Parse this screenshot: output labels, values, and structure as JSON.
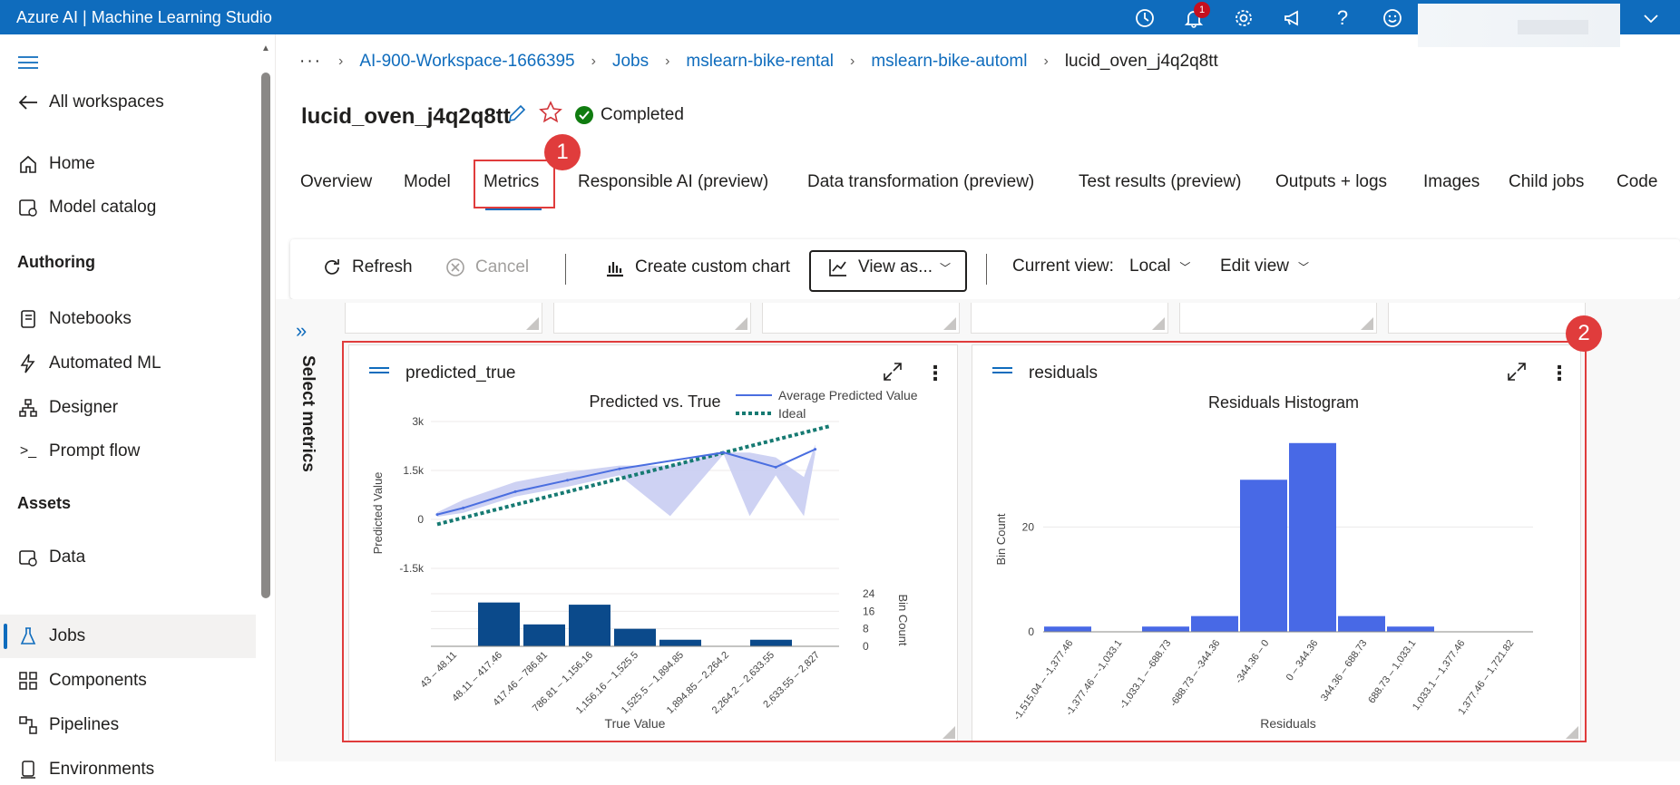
{
  "app": {
    "title": "Azure AI | Machine Learning Studio",
    "notification_count": "1"
  },
  "sidebar": {
    "all_workspaces": "All workspaces",
    "home": "Home",
    "model_catalog": "Model catalog",
    "authoring_header": "Authoring",
    "notebooks": "Notebooks",
    "automated_ml": "Automated ML",
    "designer": "Designer",
    "prompt_flow": "Prompt flow",
    "assets_header": "Assets",
    "data": "Data",
    "jobs": "Jobs",
    "components": "Components",
    "pipelines": "Pipelines",
    "environments": "Environments"
  },
  "breadcrumb": {
    "ellipsis": "···",
    "items": [
      "AI-900-Workspace-1666395",
      "Jobs",
      "mslearn-bike-rental",
      "mslearn-bike-automl"
    ],
    "current": "lucid_oven_j4q2q8tt"
  },
  "job": {
    "title": "lucid_oven_j4q2q8tt",
    "status": "Completed"
  },
  "tabs": [
    "Overview",
    "Model",
    "Metrics",
    "Responsible AI (preview)",
    "Data transformation (preview)",
    "Test results (preview)",
    "Outputs + logs",
    "Images",
    "Child jobs",
    "Code"
  ],
  "selected_tab": "Metrics",
  "toolbar": {
    "refresh": "Refresh",
    "cancel": "Cancel",
    "create_custom_chart": "Create custom chart",
    "view_as": "View as...",
    "current_view_label": "Current view:",
    "current_view_value": "Local",
    "edit_view": "Edit view"
  },
  "select_metrics": "Select metrics",
  "callouts": [
    "1",
    "2"
  ],
  "cards": {
    "predicted_true": {
      "name": "predicted_true"
    },
    "residuals": {
      "name": "residuals"
    }
  },
  "chart_data": [
    {
      "type": "line",
      "title": "Predicted vs. True",
      "xlabel": "True Value",
      "ylabel": "Predicted Value",
      "y_ticks": [
        "3k",
        "1.5k",
        "0",
        "-1.5k"
      ],
      "ylim": [
        -1500,
        3000
      ],
      "categories": [
        "43 – 48.11",
        "48.11 – 417.46",
        "417.46 – 786.81",
        "786.81 – 1,156.16",
        "1,156.16 – 1,525.5",
        "1,525.5 – 1,894.85",
        "1,894.85 – 2,264.2",
        "2,264.2 – 2,633.55",
        "2,633.55 – 2,827"
      ],
      "series": [
        {
          "name": "Average Predicted Value",
          "x": [
            45,
            230,
            600,
            970,
            1340,
            2080,
            2450,
            2730
          ],
          "values": [
            150,
            350,
            850,
            1200,
            1550,
            2050,
            1600,
            2150
          ]
        },
        {
          "name": "Ideal",
          "x": [
            45,
            2827
          ],
          "values": [
            -150,
            2850
          ]
        }
      ],
      "band": {
        "x": [
          45,
          230,
          600,
          970,
          1340,
          1700,
          2080,
          2265,
          2450,
          2650,
          2730
        ],
        "upper": [
          220,
          600,
          1150,
          1450,
          1650,
          1650,
          2050,
          2050,
          1900,
          1300,
          2300
        ],
        "lower": [
          80,
          200,
          700,
          1000,
          1350,
          100,
          2000,
          100,
          1350,
          100,
          2000
        ]
      },
      "histogram": {
        "title": "Bin Count",
        "y_ticks": [
          "24",
          "16",
          "8",
          "0"
        ],
        "ylim": [
          0,
          24
        ],
        "values": [
          0,
          20,
          10,
          19,
          8,
          3,
          0,
          3,
          0
        ]
      }
    },
    {
      "type": "bar",
      "title": "Residuals Histogram",
      "xlabel": "Residuals",
      "ylabel": "Bin Count",
      "y_ticks": [
        "20",
        "0"
      ],
      "ylim": [
        0,
        37
      ],
      "categories": [
        "-1,515.04 – -1,377.46",
        "-1,377.46 – -1,033.1",
        "-1,033.1 – -688.73",
        "-688.73 – -344.36",
        "-344.36 – 0",
        "0 – 344.36",
        "344.36 – 688.73",
        "688.73 – 1,033.1",
        "1,033.1 – 1,377.46",
        "1,377.46 – 1,721.82"
      ],
      "values": [
        1,
        0,
        1,
        3,
        29,
        36,
        3,
        1,
        0,
        0
      ]
    }
  ],
  "colors": {
    "accent": "#0f6cbd",
    "callout": "#e03c3c",
    "status_ok": "#107c10",
    "series_avg": "#4a6ee0",
    "series_ideal": "#167a72",
    "band": "#c9cdf2",
    "histogram_dark": "#0b4a8b",
    "histogram_residuals": "#4869e6"
  },
  "icons": {
    "topbar": [
      "history-icon",
      "bell-icon",
      "gear-icon",
      "megaphone-icon",
      "help-icon",
      "smiley-icon",
      "chevron-down-icon"
    ]
  }
}
